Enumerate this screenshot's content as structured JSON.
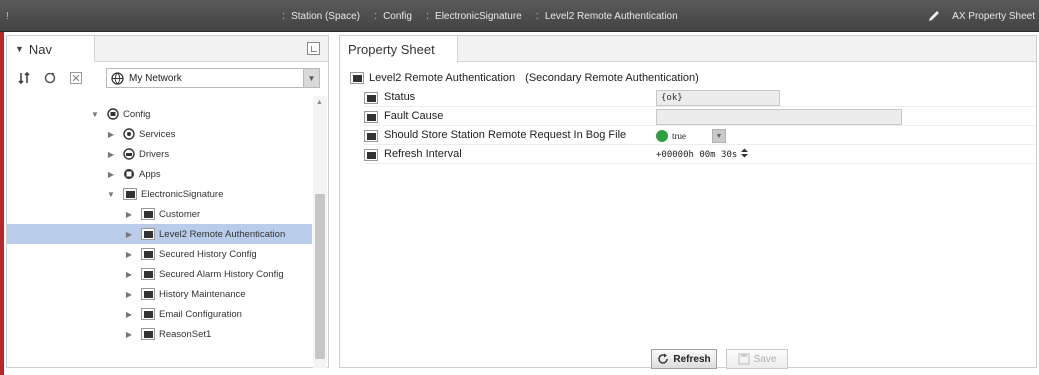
{
  "breadcrumb": {
    "start": "!",
    "items": [
      {
        "label": "Station (Space)"
      },
      {
        "label": "Config"
      },
      {
        "label": "ElectronicSignature"
      },
      {
        "label": "Level2 Remote Authentication"
      }
    ],
    "view_label": "AX Property Sheet"
  },
  "nav": {
    "tab_label": "Nav",
    "network_select": {
      "value": "My Network"
    },
    "tree": [
      {
        "label": "Config",
        "expanded": true,
        "icon": "config-icon"
      },
      {
        "label": "Services",
        "expanded": false,
        "icon": "services-icon"
      },
      {
        "label": "Drivers",
        "expanded": false,
        "icon": "drivers-icon"
      },
      {
        "label": "Apps",
        "expanded": false,
        "icon": "apps-icon"
      },
      {
        "label": "ElectronicSignature",
        "expanded": true,
        "icon": "folder-icon"
      },
      {
        "label": "Customer",
        "expanded": false,
        "icon": "folder-icon"
      },
      {
        "label": "Level2 Remote Authentication",
        "expanded": false,
        "icon": "folder-icon",
        "selected": true
      },
      {
        "label": "Secured History Config",
        "expanded": false,
        "icon": "folder-icon"
      },
      {
        "label": "Secured Alarm History Config",
        "expanded": false,
        "icon": "folder-icon"
      },
      {
        "label": "History Maintenance",
        "expanded": false,
        "icon": "folder-icon"
      },
      {
        "label": "Email Configuration",
        "expanded": false,
        "icon": "folder-icon"
      },
      {
        "label": "ReasonSet1",
        "expanded": false,
        "icon": "folder-icon"
      }
    ]
  },
  "property_sheet": {
    "tab_label": "Property Sheet",
    "root_name": "Level2 Remote Authentication",
    "root_display": "(Secondary Remote Authentication)",
    "properties": [
      {
        "name": "Status",
        "value": "{ok}"
      },
      {
        "name": "Fault Cause",
        "value": ""
      },
      {
        "name": "Should Store Station Remote Request In Bog File",
        "value": "true"
      },
      {
        "name": "Refresh Interval",
        "value": "+00000h 00m 30s"
      }
    ],
    "buttons": {
      "refresh": "Refresh",
      "save": "Save"
    }
  },
  "colors": {
    "accent": "#b5282e",
    "selection": "#b9cdea",
    "true_status": "#2ea043",
    "topbar": "#4a4a4a"
  }
}
